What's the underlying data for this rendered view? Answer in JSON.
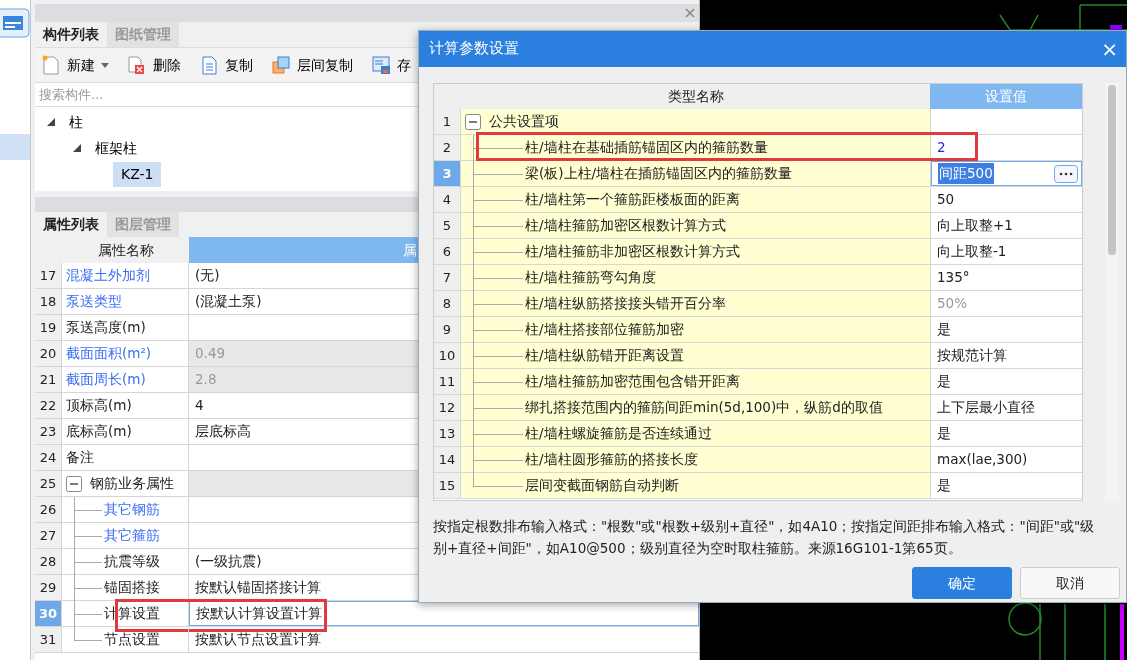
{
  "sidebar": {
    "items": [
      {
        "selected": true
      }
    ]
  },
  "component_panel": {
    "tabs": [
      {
        "label": "构件列表",
        "selected": true
      },
      {
        "label": "图纸管理",
        "selected": false
      }
    ],
    "toolbar": [
      {
        "label": "新建",
        "dropdown": true
      },
      {
        "label": "删除",
        "dropdown": false
      },
      {
        "label": "复制",
        "dropdown": false
      },
      {
        "label": "层间复制",
        "dropdown": false
      },
      {
        "label": "存",
        "dropdown": false
      }
    ],
    "search": {
      "placeholder": "搜索构件..."
    },
    "tree": [
      {
        "label": "柱",
        "expanded": true,
        "selected": false,
        "children": [
          {
            "label": "框架柱",
            "expanded": true,
            "selected": false,
            "children": [
              {
                "label": "KZ-1",
                "selected": true
              }
            ]
          }
        ]
      }
    ]
  },
  "property_panel": {
    "tabs": [
      {
        "label": "属性列表",
        "selected": true
      },
      {
        "label": "图层管理",
        "selected": false
      }
    ],
    "columns": [
      "属性名称",
      "属"
    ],
    "rows": [
      {
        "num": "17",
        "name": "混凝土外加剂",
        "link": true,
        "value": "(无)",
        "disabled": false,
        "selected": false
      },
      {
        "num": "18",
        "name": "泵送类型",
        "link": true,
        "value": "(混凝土泵)",
        "disabled": false,
        "selected": false
      },
      {
        "num": "19",
        "name": "泵送高度(m)",
        "link": false,
        "disabled": false,
        "selected": false
      },
      {
        "num": "20",
        "name": "截面面积(m²)",
        "link": true,
        "value": "0.49",
        "disabled": true,
        "selected": false
      },
      {
        "num": "21",
        "name": "截面周长(m)",
        "link": true,
        "value": "2.8",
        "disabled": true,
        "selected": false
      },
      {
        "num": "22",
        "name": "顶标高(m)",
        "link": false,
        "value": "4",
        "disabled": false,
        "selected": false
      },
      {
        "num": "23",
        "name": "底标高(m)",
        "link": false,
        "value": "层底标高",
        "disabled": false,
        "selected": false
      },
      {
        "num": "24",
        "name": "备注",
        "link": false,
        "disabled": false,
        "selected": false
      },
      {
        "num": "25",
        "name": "钢筋业务属性",
        "link": false,
        "disabled": true,
        "selected": false,
        "expanded": true,
        "children": [
          {
            "num": "26",
            "name": "其它钢筋",
            "link": true,
            "disabled": false,
            "selected": false
          },
          {
            "num": "27",
            "name": "其它箍筋",
            "link": true,
            "disabled": false,
            "selected": false
          },
          {
            "num": "28",
            "name": "抗震等级",
            "link": false,
            "value": "(一级抗震)",
            "disabled": false,
            "selected": false
          },
          {
            "num": "29",
            "name": "锚固搭接",
            "link": false,
            "value": "按默认锚固搭接计算",
            "disabled": false,
            "selected": false
          },
          {
            "num": "30",
            "name": "计算设置",
            "link": false,
            "value": "按默认计算设置计算",
            "disabled": false,
            "selected": true,
            "highlighted": true
          },
          {
            "num": "31",
            "name": "节点设置",
            "link": false,
            "value": "按默认节点设置计算",
            "disabled": false,
            "selected": false
          }
        ]
      }
    ]
  },
  "dialog": {
    "title": "计算参数设置",
    "close": "×",
    "columns": [
      "类型名称",
      "设置值"
    ],
    "rows": [
      {
        "num": "1",
        "name": "公共设置项",
        "selected": false,
        "expanded": true,
        "children": [
          {
            "num": "2",
            "name": "柱/墙柱在基础插筋锚固区内的箍筋数量",
            "value": "2",
            "kind": "link",
            "selected": false,
            "highlighted": true
          },
          {
            "num": "3",
            "name": "梁(板)上柱/墙柱在插筋锚固区内的箍筋数量",
            "value": "间距500",
            "kind": "plain",
            "selected": true
          },
          {
            "num": "4",
            "name": "柱/墙柱第一个箍筋距楼板面的距离",
            "value": "50",
            "kind": "plain",
            "selected": false
          },
          {
            "num": "5",
            "name": "柱/墙柱箍筋加密区根数计算方式",
            "value": "向上取整+1",
            "kind": "plain",
            "selected": false
          },
          {
            "num": "6",
            "name": "柱/墙柱箍筋非加密区根数计算方式",
            "value": "向上取整-1",
            "kind": "plain",
            "selected": false
          },
          {
            "num": "7",
            "name": "柱/墙柱箍筋弯勾角度",
            "value": "135°",
            "kind": "plain",
            "selected": false
          },
          {
            "num": "8",
            "name": "柱/墙柱纵筋搭接接头错开百分率",
            "value": "50%",
            "kind": "muted",
            "selected": false
          },
          {
            "num": "9",
            "name": "柱/墙柱搭接部位箍筋加密",
            "value": "是",
            "kind": "plain",
            "selected": false
          },
          {
            "num": "10",
            "name": "柱/墙柱纵筋错开距离设置",
            "value": "按规范计算",
            "kind": "plain",
            "selected": false
          },
          {
            "num": "11",
            "name": "柱/墙柱箍筋加密范围包含错开距离",
            "value": "是",
            "kind": "plain",
            "selected": false
          },
          {
            "num": "12",
            "name": "绑扎搭接范围内的箍筋间距min(5d,100)中，纵筋d的取值",
            "value": "上下层最小直径",
            "kind": "plain",
            "selected": false
          },
          {
            "num": "13",
            "name": "柱/墙柱螺旋箍筋是否连续通过",
            "value": "是",
            "kind": "plain",
            "selected": false
          },
          {
            "num": "14",
            "name": "柱/墙柱圆形箍筋的搭接长度",
            "value": "max(lae,300)",
            "kind": "plain",
            "selected": false
          },
          {
            "num": "15",
            "name": "层间变截面钢筋自动判断",
            "value": "是",
            "kind": "plain",
            "selected": false
          }
        ]
      }
    ],
    "help_text": "按指定根数排布输入格式：\"根数\"或\"根数+级别+直径\"，如4A10；按指定间距排布输入格式：\"间距\"或\"级别+直径+间距\"，如A10@500；级别直径为空时取柱箍筋。来源16G101-1第65页。",
    "buttons": [
      {
        "label": "确定",
        "primary": true
      },
      {
        "label": "取消",
        "primary": false
      }
    ]
  }
}
